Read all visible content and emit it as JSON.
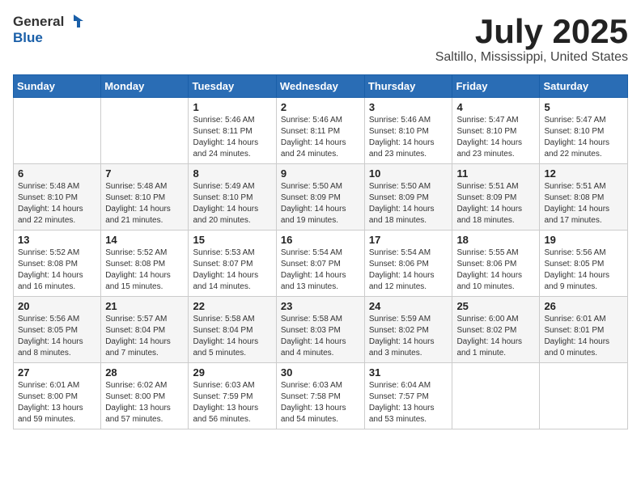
{
  "header": {
    "logo_general": "General",
    "logo_blue": "Blue",
    "month": "July 2025",
    "location": "Saltillo, Mississippi, United States"
  },
  "weekdays": [
    "Sunday",
    "Monday",
    "Tuesday",
    "Wednesday",
    "Thursday",
    "Friday",
    "Saturday"
  ],
  "weeks": [
    [
      {
        "day": "",
        "sunrise": "",
        "sunset": "",
        "daylight": ""
      },
      {
        "day": "",
        "sunrise": "",
        "sunset": "",
        "daylight": ""
      },
      {
        "day": "1",
        "sunrise": "Sunrise: 5:46 AM",
        "sunset": "Sunset: 8:11 PM",
        "daylight": "Daylight: 14 hours and 24 minutes."
      },
      {
        "day": "2",
        "sunrise": "Sunrise: 5:46 AM",
        "sunset": "Sunset: 8:11 PM",
        "daylight": "Daylight: 14 hours and 24 minutes."
      },
      {
        "day": "3",
        "sunrise": "Sunrise: 5:46 AM",
        "sunset": "Sunset: 8:10 PM",
        "daylight": "Daylight: 14 hours and 23 minutes."
      },
      {
        "day": "4",
        "sunrise": "Sunrise: 5:47 AM",
        "sunset": "Sunset: 8:10 PM",
        "daylight": "Daylight: 14 hours and 23 minutes."
      },
      {
        "day": "5",
        "sunrise": "Sunrise: 5:47 AM",
        "sunset": "Sunset: 8:10 PM",
        "daylight": "Daylight: 14 hours and 22 minutes."
      }
    ],
    [
      {
        "day": "6",
        "sunrise": "Sunrise: 5:48 AM",
        "sunset": "Sunset: 8:10 PM",
        "daylight": "Daylight: 14 hours and 22 minutes."
      },
      {
        "day": "7",
        "sunrise": "Sunrise: 5:48 AM",
        "sunset": "Sunset: 8:10 PM",
        "daylight": "Daylight: 14 hours and 21 minutes."
      },
      {
        "day": "8",
        "sunrise": "Sunrise: 5:49 AM",
        "sunset": "Sunset: 8:10 PM",
        "daylight": "Daylight: 14 hours and 20 minutes."
      },
      {
        "day": "9",
        "sunrise": "Sunrise: 5:50 AM",
        "sunset": "Sunset: 8:09 PM",
        "daylight": "Daylight: 14 hours and 19 minutes."
      },
      {
        "day": "10",
        "sunrise": "Sunrise: 5:50 AM",
        "sunset": "Sunset: 8:09 PM",
        "daylight": "Daylight: 14 hours and 18 minutes."
      },
      {
        "day": "11",
        "sunrise": "Sunrise: 5:51 AM",
        "sunset": "Sunset: 8:09 PM",
        "daylight": "Daylight: 14 hours and 18 minutes."
      },
      {
        "day": "12",
        "sunrise": "Sunrise: 5:51 AM",
        "sunset": "Sunset: 8:08 PM",
        "daylight": "Daylight: 14 hours and 17 minutes."
      }
    ],
    [
      {
        "day": "13",
        "sunrise": "Sunrise: 5:52 AM",
        "sunset": "Sunset: 8:08 PM",
        "daylight": "Daylight: 14 hours and 16 minutes."
      },
      {
        "day": "14",
        "sunrise": "Sunrise: 5:52 AM",
        "sunset": "Sunset: 8:08 PM",
        "daylight": "Daylight: 14 hours and 15 minutes."
      },
      {
        "day": "15",
        "sunrise": "Sunrise: 5:53 AM",
        "sunset": "Sunset: 8:07 PM",
        "daylight": "Daylight: 14 hours and 14 minutes."
      },
      {
        "day": "16",
        "sunrise": "Sunrise: 5:54 AM",
        "sunset": "Sunset: 8:07 PM",
        "daylight": "Daylight: 14 hours and 13 minutes."
      },
      {
        "day": "17",
        "sunrise": "Sunrise: 5:54 AM",
        "sunset": "Sunset: 8:06 PM",
        "daylight": "Daylight: 14 hours and 12 minutes."
      },
      {
        "day": "18",
        "sunrise": "Sunrise: 5:55 AM",
        "sunset": "Sunset: 8:06 PM",
        "daylight": "Daylight: 14 hours and 10 minutes."
      },
      {
        "day": "19",
        "sunrise": "Sunrise: 5:56 AM",
        "sunset": "Sunset: 8:05 PM",
        "daylight": "Daylight: 14 hours and 9 minutes."
      }
    ],
    [
      {
        "day": "20",
        "sunrise": "Sunrise: 5:56 AM",
        "sunset": "Sunset: 8:05 PM",
        "daylight": "Daylight: 14 hours and 8 minutes."
      },
      {
        "day": "21",
        "sunrise": "Sunrise: 5:57 AM",
        "sunset": "Sunset: 8:04 PM",
        "daylight": "Daylight: 14 hours and 7 minutes."
      },
      {
        "day": "22",
        "sunrise": "Sunrise: 5:58 AM",
        "sunset": "Sunset: 8:04 PM",
        "daylight": "Daylight: 14 hours and 5 minutes."
      },
      {
        "day": "23",
        "sunrise": "Sunrise: 5:58 AM",
        "sunset": "Sunset: 8:03 PM",
        "daylight": "Daylight: 14 hours and 4 minutes."
      },
      {
        "day": "24",
        "sunrise": "Sunrise: 5:59 AM",
        "sunset": "Sunset: 8:02 PM",
        "daylight": "Daylight: 14 hours and 3 minutes."
      },
      {
        "day": "25",
        "sunrise": "Sunrise: 6:00 AM",
        "sunset": "Sunset: 8:02 PM",
        "daylight": "Daylight: 14 hours and 1 minute."
      },
      {
        "day": "26",
        "sunrise": "Sunrise: 6:01 AM",
        "sunset": "Sunset: 8:01 PM",
        "daylight": "Daylight: 14 hours and 0 minutes."
      }
    ],
    [
      {
        "day": "27",
        "sunrise": "Sunrise: 6:01 AM",
        "sunset": "Sunset: 8:00 PM",
        "daylight": "Daylight: 13 hours and 59 minutes."
      },
      {
        "day": "28",
        "sunrise": "Sunrise: 6:02 AM",
        "sunset": "Sunset: 8:00 PM",
        "daylight": "Daylight: 13 hours and 57 minutes."
      },
      {
        "day": "29",
        "sunrise": "Sunrise: 6:03 AM",
        "sunset": "Sunset: 7:59 PM",
        "daylight": "Daylight: 13 hours and 56 minutes."
      },
      {
        "day": "30",
        "sunrise": "Sunrise: 6:03 AM",
        "sunset": "Sunset: 7:58 PM",
        "daylight": "Daylight: 13 hours and 54 minutes."
      },
      {
        "day": "31",
        "sunrise": "Sunrise: 6:04 AM",
        "sunset": "Sunset: 7:57 PM",
        "daylight": "Daylight: 13 hours and 53 minutes."
      },
      {
        "day": "",
        "sunrise": "",
        "sunset": "",
        "daylight": ""
      },
      {
        "day": "",
        "sunrise": "",
        "sunset": "",
        "daylight": ""
      }
    ]
  ]
}
